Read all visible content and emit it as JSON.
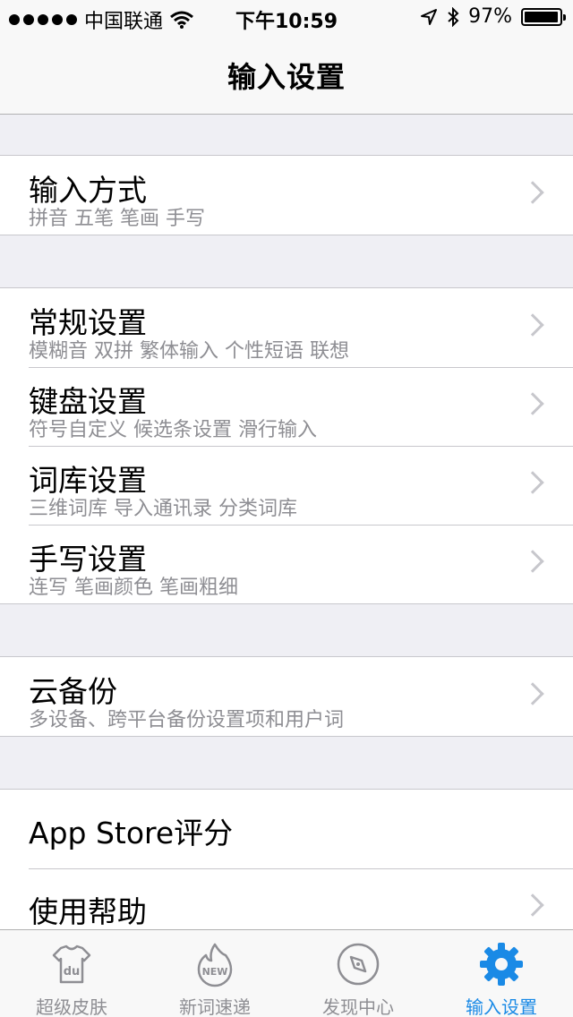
{
  "status_bar": {
    "carrier": "中国联通",
    "time": "下午10:59",
    "battery": "97%",
    "battery_level": 0.97
  },
  "nav": {
    "title": "输入设置"
  },
  "groups": [
    {
      "rows": [
        {
          "title": "输入方式",
          "subtitle": "拼音 五笔 笔画 手写"
        }
      ]
    },
    {
      "rows": [
        {
          "title": "常规设置",
          "subtitle": "模糊音 双拼 繁体输入 个性短语 联想"
        },
        {
          "title": "键盘设置",
          "subtitle": "符号自定义 候选条设置 滑行输入"
        },
        {
          "title": "词库设置",
          "subtitle": "三维词库 导入通讯录 分类词库"
        },
        {
          "title": "手写设置",
          "subtitle": "连写 笔画颜色 笔画粗细"
        }
      ]
    },
    {
      "rows": [
        {
          "title": "云备份",
          "subtitle": "多设备、跨平台备份设置项和用户词"
        }
      ]
    },
    {
      "rows": [
        {
          "title": "App Store评分"
        },
        {
          "title": "使用帮助"
        }
      ]
    }
  ],
  "tabs": [
    {
      "label": "超级皮肤",
      "icon": "shirt-icon"
    },
    {
      "label": "新词速递",
      "icon": "flame-new-icon"
    },
    {
      "label": "发现中心",
      "icon": "compass-icon"
    },
    {
      "label": "输入设置",
      "icon": "gear-icon",
      "active": true
    }
  ],
  "colors": {
    "accent": "#1a8ae6",
    "background": "#efeff4",
    "subtitle": "#8e8e93"
  }
}
